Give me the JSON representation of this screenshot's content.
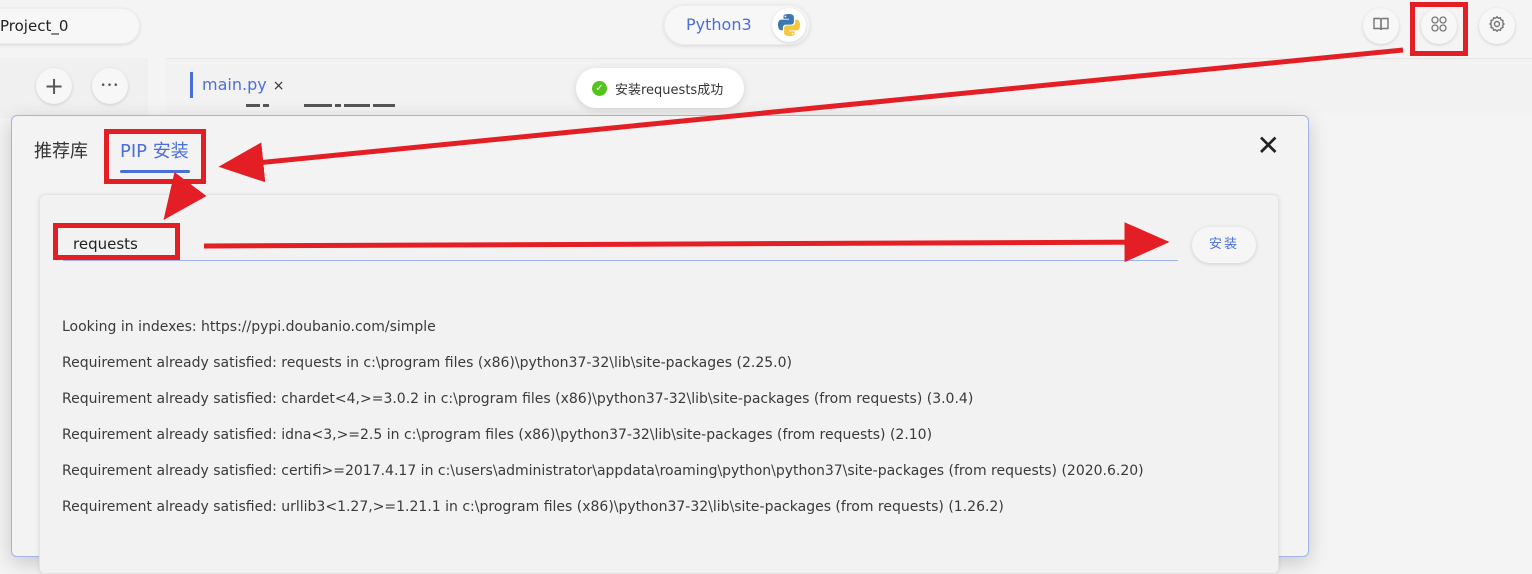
{
  "header": {
    "project_name": "Project_0",
    "language": "Python3",
    "icons": [
      "book-icon",
      "apps-icon",
      "settings-icon"
    ]
  },
  "sidebar": {
    "add_label": "+",
    "more_label": "•••"
  },
  "editor": {
    "tab_name": "main.py",
    "tab_close": "×"
  },
  "toast": {
    "message": "安装requests成功",
    "status": "success"
  },
  "dialog": {
    "tabs": [
      {
        "label": "推荐库",
        "active": false
      },
      {
        "label": "PIP 安装",
        "active": true
      }
    ],
    "close_label": "✕",
    "input_value": "requests",
    "install_label": "安装",
    "log_lines": [
      "Looking in indexes: https://pypi.doubanio.com/simple",
      "Requirement already satisfied: requests in c:\\program files (x86)\\python37-32\\lib\\site-packages (2.25.0)",
      "Requirement already satisfied: chardet<4,>=3.0.2 in c:\\program files (x86)\\python37-32\\lib\\site-packages (from requests) (3.0.4)",
      "Requirement already satisfied: idna<3,>=2.5 in c:\\program files (x86)\\python37-32\\lib\\site-packages (from requests) (2.10)",
      "Requirement already satisfied: certifi>=2017.4.17 in c:\\users\\administrator\\appdata\\roaming\\python\\python37\\site-packages (from requests) (2020.6.20)",
      "Requirement already satisfied: urllib3<1.27,>=1.21.1 in c:\\program files (x86)\\python37-32\\lib\\site-packages (from requests) (1.26.2)"
    ]
  },
  "colors": {
    "accent": "#4a6fd8",
    "annotation": "#e31e24",
    "success": "#52c41a"
  }
}
